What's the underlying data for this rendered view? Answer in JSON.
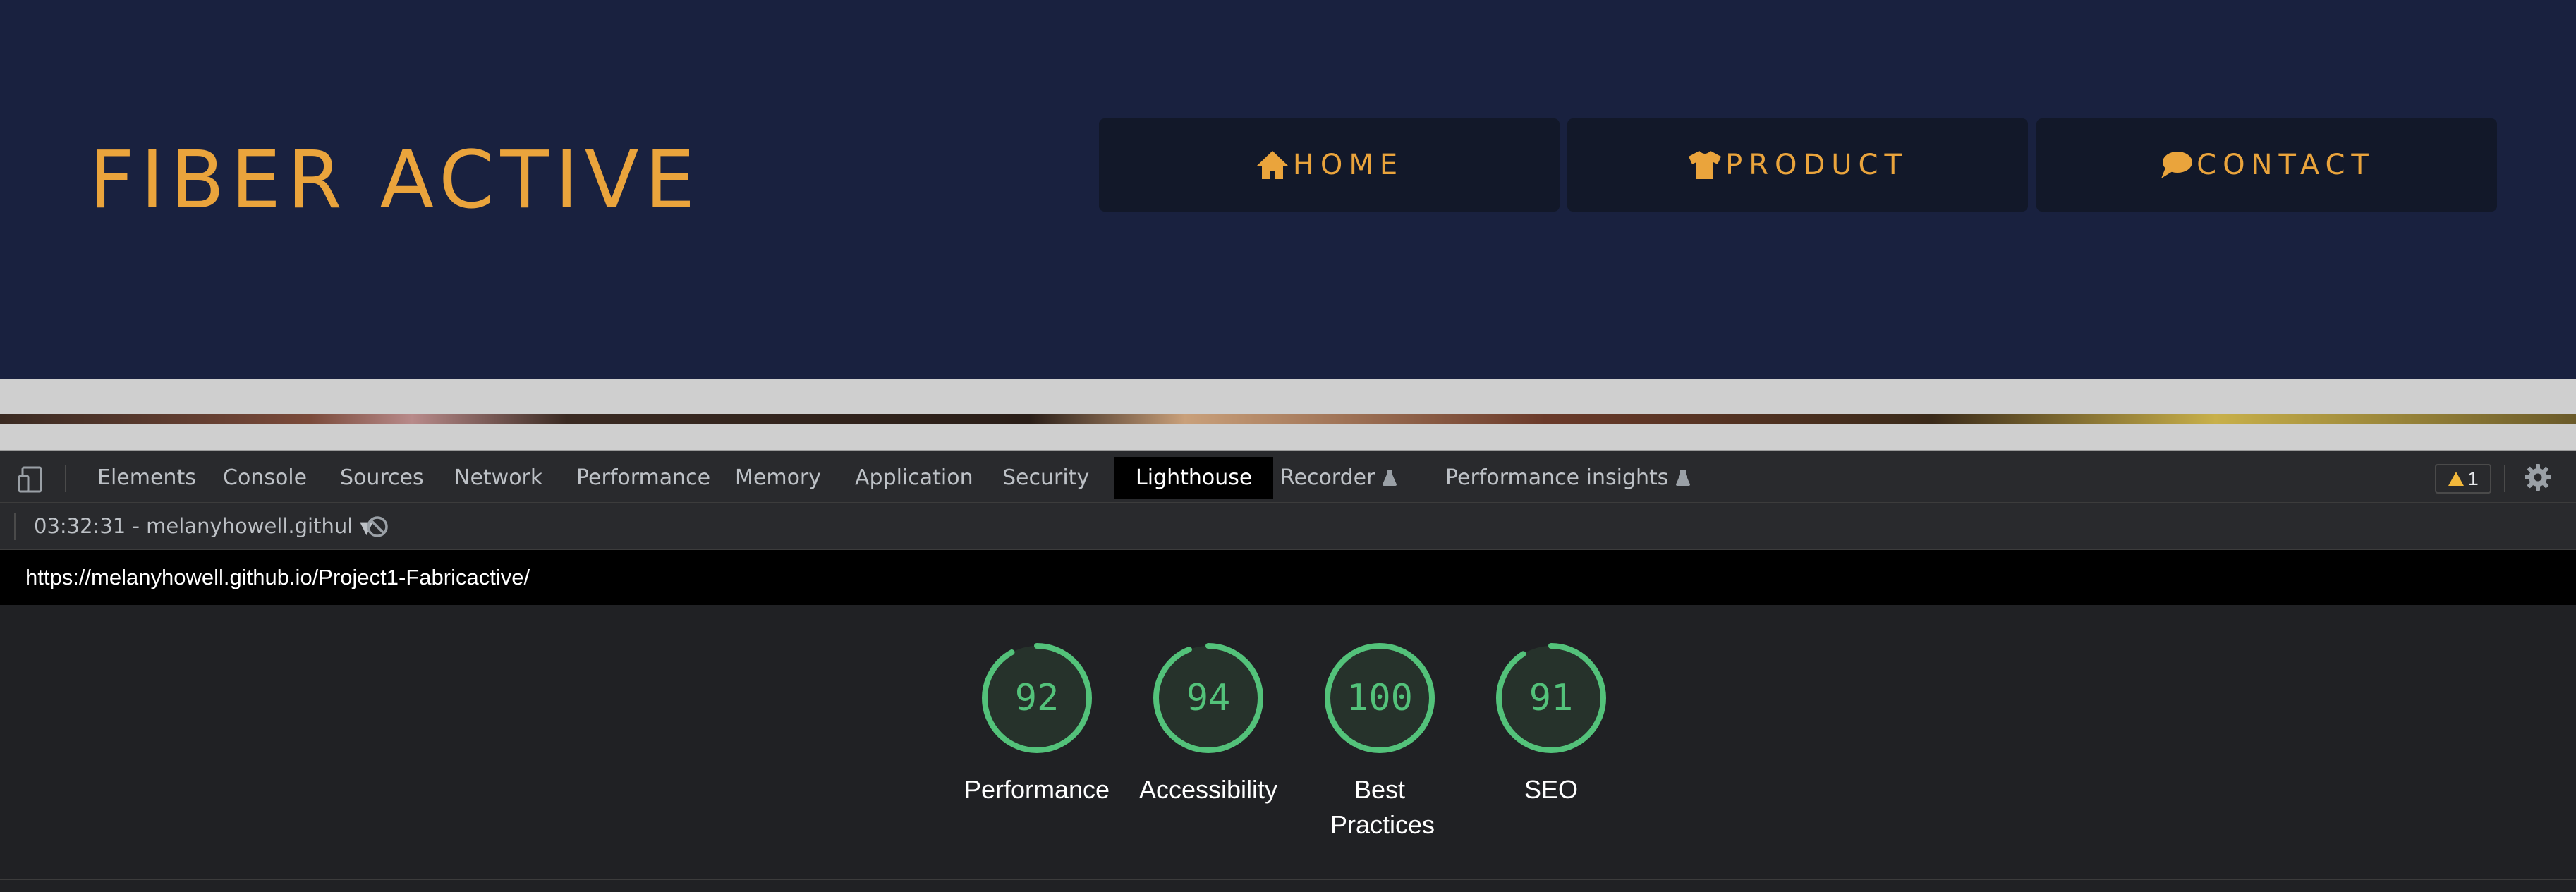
{
  "site": {
    "logo": "FIBER ACTIVE",
    "nav": [
      {
        "label": "HOME",
        "icon": "home-icon"
      },
      {
        "label": "PRODUCT",
        "icon": "tshirt-icon"
      },
      {
        "label": "CONTACT",
        "icon": "comment-icon"
      }
    ],
    "accent_color": "#eaa43c",
    "background_color": "#19213f"
  },
  "devtools": {
    "tabs": [
      "Elements",
      "Console",
      "Sources",
      "Network",
      "Performance",
      "Memory",
      "Application",
      "Security",
      "Lighthouse",
      "Recorder",
      "Performance insights"
    ],
    "active_tab": "Lighthouse",
    "warning_count": "1",
    "report_selector": "03:32:31 - melanyhowell.githul",
    "url": "https://melanyhowell.github.io/Project1-Fabricactive/",
    "scores": [
      {
        "label": "Performance",
        "score": "92",
        "value": 92
      },
      {
        "label": "Accessibility",
        "score": "94",
        "value": 94
      },
      {
        "label": "Best Practices",
        "score": "100",
        "value": 100
      },
      {
        "label": "SEO",
        "score": "91",
        "value": 91
      }
    ],
    "score_color": "#53c27a"
  }
}
